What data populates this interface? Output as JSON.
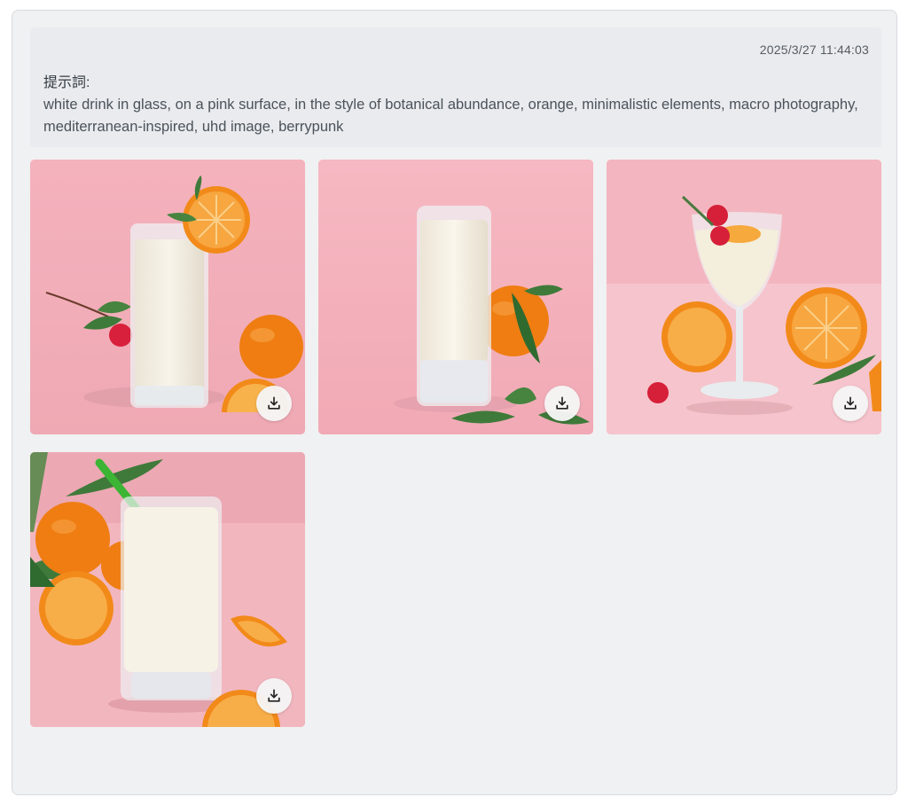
{
  "record": {
    "timestamp": "2025/3/27 11:44:03",
    "prompt_label": "提示詞:",
    "prompt_text": "white drink in glass, on a pink surface, in the style of botanical abundance, orange, minimalistic elements, macro photography, mediterranean-inspired, uhd image, berrypunk"
  },
  "images": [
    {
      "id": "image-1",
      "icon": "download-icon"
    },
    {
      "id": "image-2",
      "icon": "download-icon"
    },
    {
      "id": "image-3",
      "icon": "download-icon"
    },
    {
      "id": "image-4",
      "icon": "download-icon"
    }
  ],
  "colors": {
    "card_background": "#f0f1f2",
    "prompt_panel": "#e9ebee",
    "pink_surface": "#f3b3bd",
    "orange": "#f28a1a",
    "leaf": "#3f7a3a",
    "milk": "#f4efe2"
  }
}
